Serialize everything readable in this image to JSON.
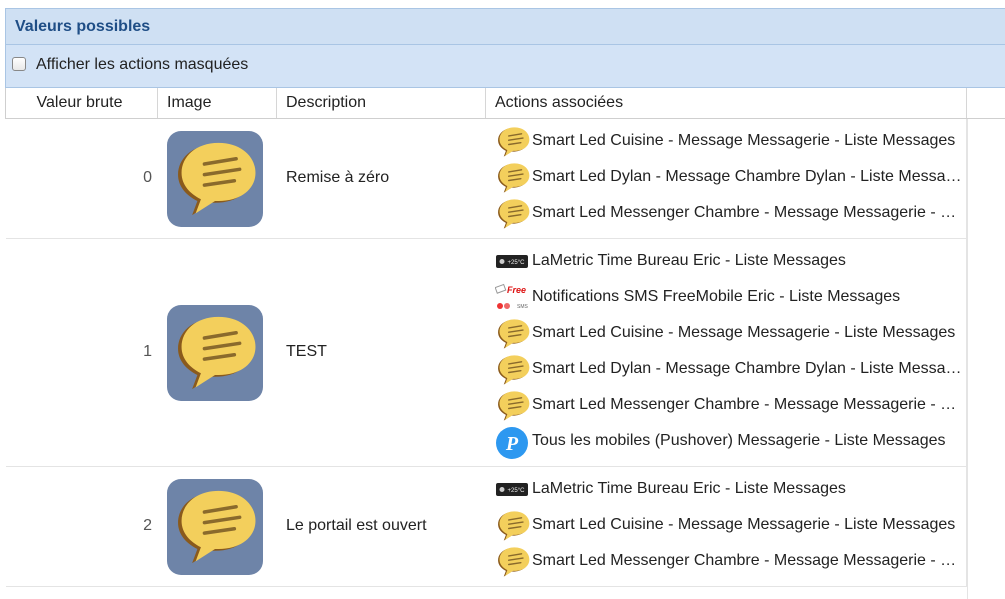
{
  "panel": {
    "title": "Valeurs possibles"
  },
  "options": {
    "show_hidden_label": "Afficher les actions masquées",
    "show_hidden_checked": false
  },
  "columns": [
    "Valeur brute",
    "Image",
    "Description",
    "Actions associées"
  ],
  "rows": [
    {
      "value": "0",
      "image": "speech-bubble-icon",
      "description": "Remise à zéro",
      "actions": [
        {
          "icon": "speech-bubble-icon",
          "label": "Smart Led Cuisine - Message Messagerie - Liste Messages"
        },
        {
          "icon": "speech-bubble-icon",
          "label": "Smart Led Dylan - Message Chambre Dylan - Liste Messages"
        },
        {
          "icon": "speech-bubble-icon",
          "label": "Smart Led Messenger Chambre - Message Messagerie - Liste Messages"
        }
      ]
    },
    {
      "value": "1",
      "image": "speech-bubble-icon",
      "description": "TEST",
      "actions": [
        {
          "icon": "lametric-icon",
          "label": "LaMetric Time Bureau Eric - Liste Messages"
        },
        {
          "icon": "freemobile-icon",
          "label": "Notifications SMS FreeMobile Eric - Liste Messages"
        },
        {
          "icon": "speech-bubble-icon",
          "label": "Smart Led Cuisine - Message Messagerie - Liste Messages"
        },
        {
          "icon": "speech-bubble-icon",
          "label": "Smart Led Dylan - Message Chambre Dylan - Liste Messages"
        },
        {
          "icon": "speech-bubble-icon",
          "label": "Smart Led Messenger Chambre - Message Messagerie - Liste Messages"
        },
        {
          "icon": "pushover-icon",
          "label": "Tous les mobiles (Pushover) Messagerie - Liste Messages"
        }
      ]
    },
    {
      "value": "2",
      "image": "speech-bubble-icon",
      "description": "Le portail est ouvert",
      "actions": [
        {
          "icon": "lametric-icon",
          "label": "LaMetric Time Bureau Eric - Liste Messages"
        },
        {
          "icon": "speech-bubble-icon",
          "label": "Smart Led Cuisine - Message Messagerie - Liste Messages"
        },
        {
          "icon": "speech-bubble-icon",
          "label": "Smart Led Messenger Chambre - Message Messagerie - Liste Messages"
        }
      ]
    }
  ],
  "icon_texts": {
    "lametric_temp": "+25°C",
    "freemobile_brand": "Free",
    "freemobile_sms": "SMS"
  },
  "colors": {
    "header_bg": "#cfe0f3",
    "title": "#1f4e86",
    "bubble": "#f3cf5c",
    "tile": "#6e84a8",
    "pushover": "#2d98f0"
  }
}
